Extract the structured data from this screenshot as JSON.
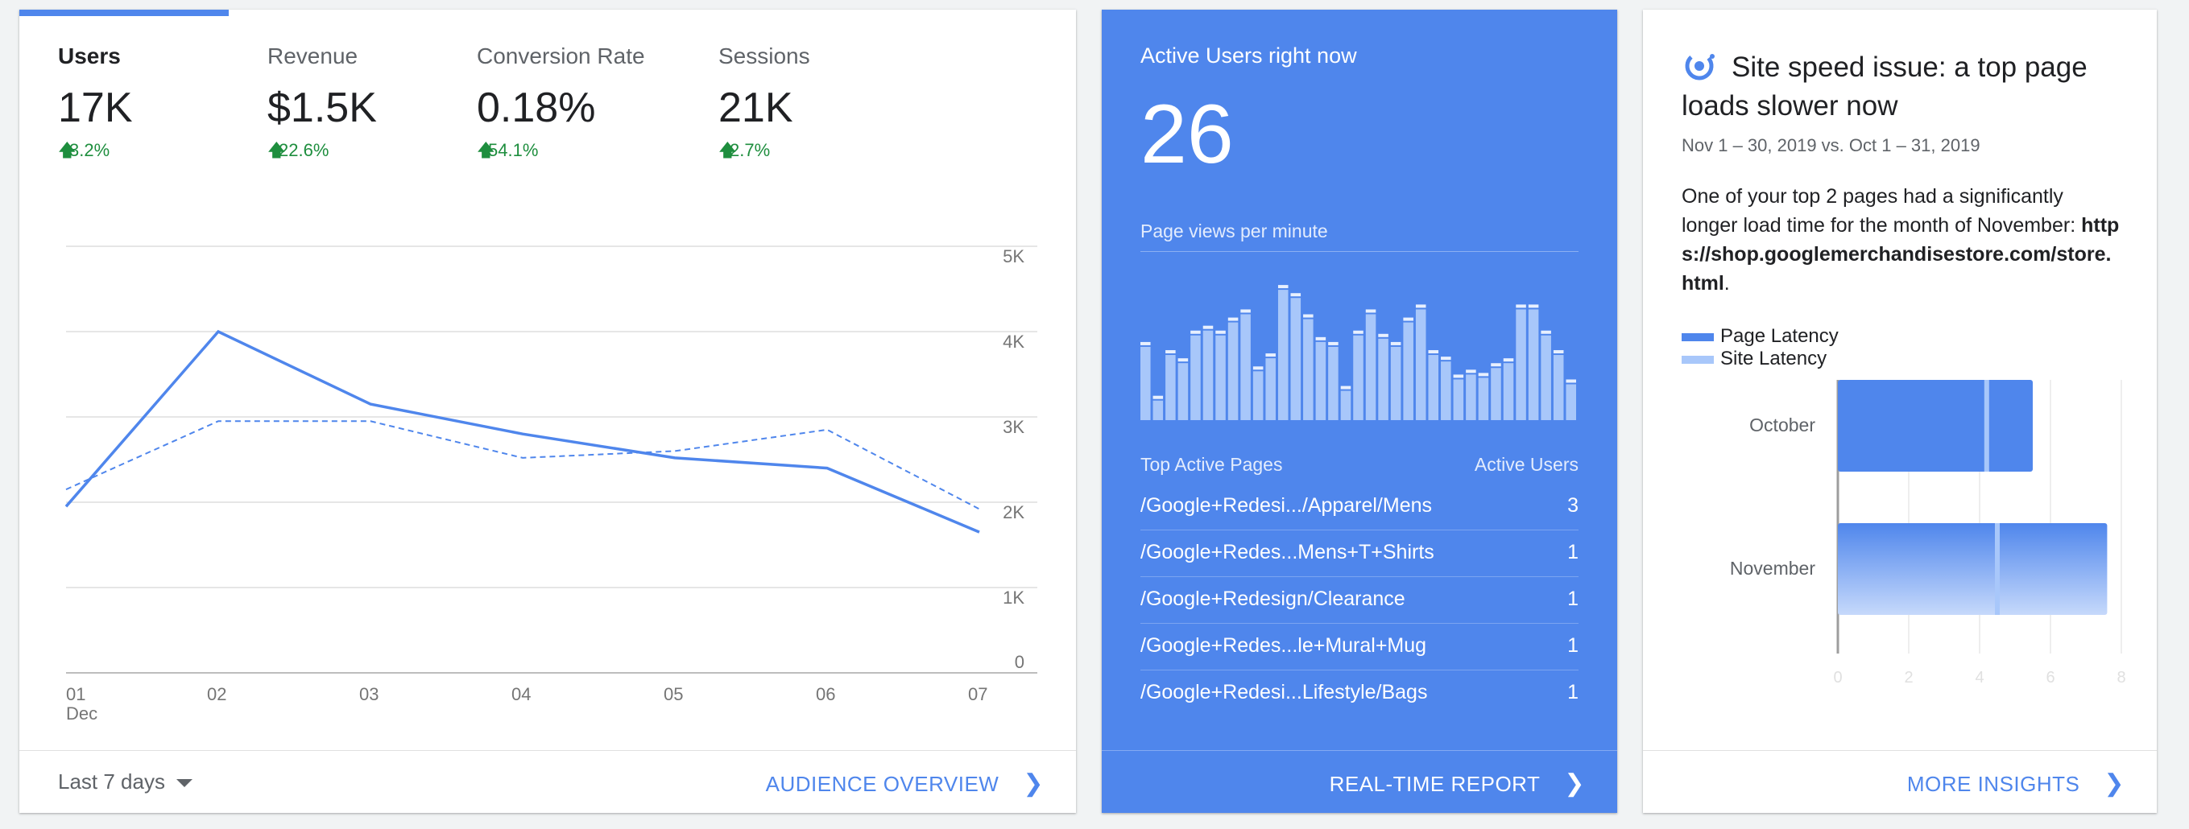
{
  "audience": {
    "metrics": [
      {
        "label": "Users",
        "value": "17K",
        "delta": "3.2%",
        "active": true
      },
      {
        "label": "Revenue",
        "value": "$1.5K",
        "delta": "22.6%",
        "active": false
      },
      {
        "label": "Conversion Rate",
        "value": "0.18%",
        "delta": "54.1%",
        "active": false
      },
      {
        "label": "Sessions",
        "value": "21K",
        "delta": "2.7%",
        "active": false
      }
    ],
    "date_range": "Last 7 days",
    "link": "AUDIENCE OVERVIEW"
  },
  "chart_data": [
    {
      "type": "line",
      "x": [
        "01",
        "02",
        "03",
        "04",
        "05",
        "06",
        "07"
      ],
      "x_sublabel": "Dec",
      "y_ticks": [
        "0",
        "1K",
        "2K",
        "3K",
        "4K",
        "5K"
      ],
      "ylim": [
        0,
        5000
      ],
      "series": [
        {
          "values": [
            1950,
            4000,
            3150,
            2800,
            2520,
            2400,
            1650
          ],
          "style": "solid"
        },
        {
          "values": [
            2150,
            2950,
            2950,
            2520,
            2600,
            2850,
            1920
          ],
          "style": "dashed"
        }
      ],
      "grid": true,
      "color": "#4f86ec"
    },
    {
      "type": "bar",
      "title": "Page views per minute",
      "values": [
        45,
        12,
        40,
        35,
        52,
        55,
        52,
        60,
        65,
        30,
        38,
        80,
        75,
        62,
        48,
        45,
        18,
        52,
        65,
        50,
        45,
        60,
        68,
        40,
        36,
        25,
        28,
        26,
        32,
        35,
        68,
        68,
        52,
        40,
        22
      ]
    },
    {
      "type": "bar",
      "orientation": "horizontal",
      "categories": [
        "October",
        "November"
      ],
      "series": [
        {
          "name": "Page Latency",
          "values": [
            5.5,
            7.6
          ]
        },
        {
          "name": "Site Latency",
          "values": [
            4.2,
            4.5
          ]
        }
      ],
      "x_ticks": [
        "0",
        "2",
        "4",
        "6",
        "8"
      ],
      "xlim": [
        0,
        8
      ]
    }
  ],
  "realtime": {
    "title": "Active Users right now",
    "count": "26",
    "pv_label": "Page views per minute",
    "table_header": {
      "page": "Top Active Pages",
      "users": "Active Users"
    },
    "rows": [
      {
        "page": "/Google+Redesi.../Apparel/Mens",
        "count": "3"
      },
      {
        "page": "/Google+Redes...Mens+T+Shirts",
        "count": "1"
      },
      {
        "page": "/Google+Redesign/Clearance",
        "count": "1"
      },
      {
        "page": "/Google+Redes...le+Mural+Mug",
        "count": "1"
      },
      {
        "page": "/Google+Redesi...Lifestyle/Bags",
        "count": "1"
      }
    ],
    "link": "REAL-TIME REPORT"
  },
  "insights": {
    "title": "Site speed issue: a top page loads slower now",
    "date": "Nov 1 – 30, 2019 vs. Oct 1 – 31, 2019",
    "desc_prefix": "One of your top 2 pages had a significantly longer load time for the month of November: ",
    "desc_url": "https://shop.googlemerchandisestore.com/store.html",
    "desc_suffix": ".",
    "legend": [
      "Page Latency",
      "Site Latency"
    ],
    "link": "MORE INSIGHTS"
  },
  "colors": {
    "accent": "#4f86ec",
    "positive": "#1e8e3e",
    "light_blue": "#a8c7fa"
  }
}
